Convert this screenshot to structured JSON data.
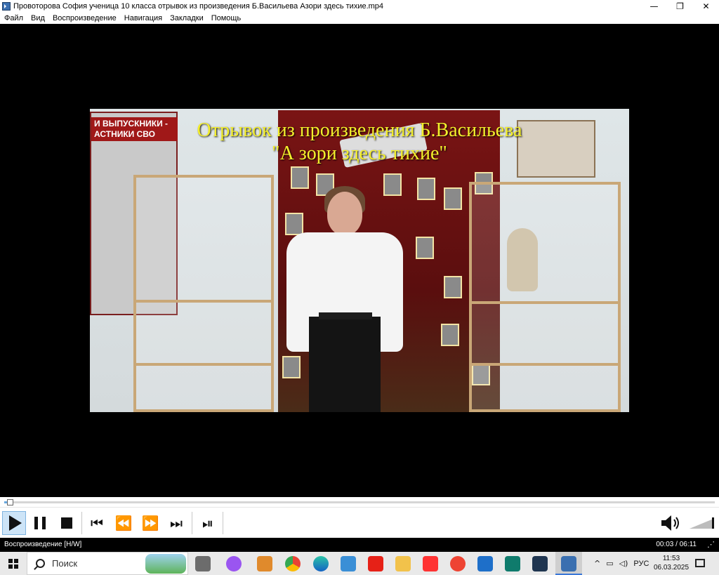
{
  "window": {
    "title": "Провоторова София ученица 10 класса отрывок из произведения Б.Васильева Азори здесь тихие.mp4",
    "minimize_label": "—",
    "restore_label": "❐",
    "close_label": "✕"
  },
  "menu": {
    "items": [
      {
        "label": "Файл"
      },
      {
        "label": "Вид"
      },
      {
        "label": "Воспроизведение"
      },
      {
        "label": "Навигация"
      },
      {
        "label": "Закладки"
      },
      {
        "label": "Помощь"
      }
    ]
  },
  "video": {
    "subtitle_line1": "Отрывок из произведения Б.Васильева",
    "subtitle_line2": "\"А зори здесь тихие\"",
    "banner_left_text": "И ВЫПУСКНИКИ - АСТНИКИ СВО",
    "subtitle_color": "#f4ef2c"
  },
  "seek": {
    "position_fraction": 0.008
  },
  "controls": {
    "play": "play-icon",
    "pause": "pause-icon",
    "stop": "stop-icon",
    "prev": "⏮",
    "rewind": "⏪",
    "forward": "⏩",
    "next": "⏭",
    "frame_step": "⏯",
    "volume": "speaker-icon",
    "volume_level_fraction": 1.0
  },
  "status": {
    "state": "Воспроизведение [H/W]",
    "time": "00:03 / 06:11"
  },
  "taskbar": {
    "search_placeholder": "Поиск",
    "language": "РУС",
    "time": "11:53",
    "date": "06.03.2025",
    "accent": "#3b78d8"
  }
}
